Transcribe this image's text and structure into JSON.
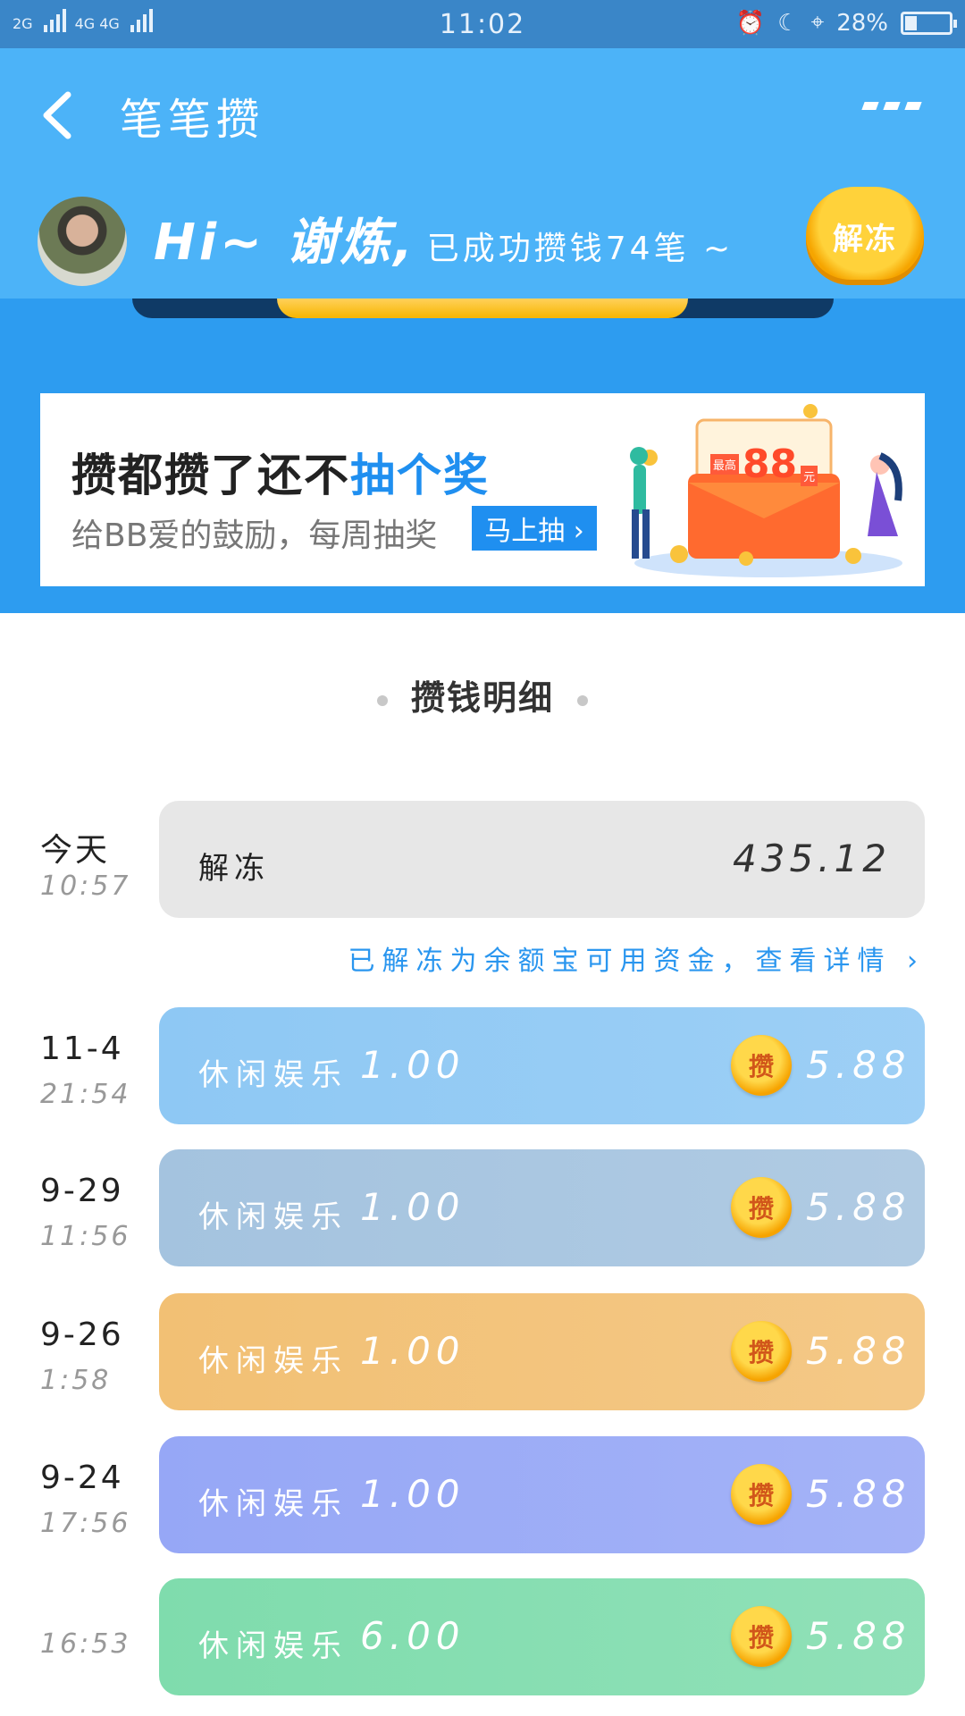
{
  "status_bar": {
    "signal_left": "2G",
    "signal_right": "4G 4G",
    "time": "11:02",
    "battery": "28%",
    "battery_level": 0.28
  },
  "header": {
    "title": "笔笔攒",
    "greeting": "Hi~ 谢炼,",
    "greeting_sub": "已成功攒钱74笔 ~",
    "unfreeze_button": "解冻"
  },
  "banner": {
    "title_plain": "攒都攒了还不",
    "title_highlight": "抽个奖",
    "subtitle": "给BB爱的鼓励，每周抽奖",
    "button": "马上抽 ›",
    "prize_small": "最高",
    "prize_value": "88",
    "prize_unit": "元"
  },
  "section_title": "攒钱明细",
  "unfreeze_record": {
    "date": "今天",
    "time": "10:57",
    "label": "解冻",
    "amount": "435.12",
    "hint": "已解冻为余额宝可用资金，查看详情 ›"
  },
  "records": [
    {
      "date": "11-4",
      "time": "21:54",
      "category": "休闲娱乐",
      "amount": "1.00",
      "coin": "攒",
      "reward": "5.88",
      "color": "#8ec8f4"
    },
    {
      "date": "9-29",
      "time": "11:56",
      "category": "休闲娱乐",
      "amount": "1.00",
      "coin": "攒",
      "reward": "5.88",
      "color": "#a4c3df"
    },
    {
      "date": "9-26",
      "time": "1:58",
      "category": "休闲娱乐",
      "amount": "1.00",
      "coin": "攒",
      "reward": "5.88",
      "color": "#f2c074"
    },
    {
      "date": "9-24",
      "time": "17:56",
      "category": "休闲娱乐",
      "amount": "1.00",
      "coin": "攒",
      "reward": "5.88",
      "color": "#96a7f6"
    },
    {
      "date": "",
      "time": "16:53",
      "category": "休闲娱乐",
      "amount": "6.00",
      "coin": "攒",
      "reward": "5.88",
      "color": "#7fdcad"
    }
  ]
}
